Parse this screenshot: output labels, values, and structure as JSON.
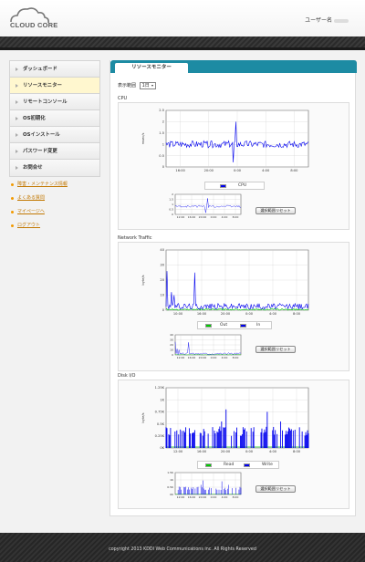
{
  "header": {
    "logo_text": "CLOUD CORE",
    "username_label": "ユーザー名"
  },
  "sidebar": {
    "items": [
      {
        "label": "ダッシュボード"
      },
      {
        "label": "リソースモニター"
      },
      {
        "label": "リモートコンソール"
      },
      {
        "label": "OS初期化"
      },
      {
        "label": "OSインストール"
      },
      {
        "label": "パスワード変更"
      },
      {
        "label": "お問合せ"
      }
    ],
    "links": [
      {
        "label": "障害・メンテナンス情報"
      },
      {
        "label": "よくある質問"
      },
      {
        "label": "マイページへ"
      },
      {
        "label": "ログアウト"
      }
    ]
  },
  "main": {
    "tab_label": "リソースモニター",
    "range_label": "表示範囲",
    "range_value": "1日",
    "reset_label": "選択範囲リセット"
  },
  "colors": {
    "accent": "#1d8ba3",
    "series_blue": "#0000ee",
    "series_green": "#00cc00",
    "link": "#c27700"
  },
  "chart_data": [
    {
      "type": "line",
      "title": "CPU",
      "ylabel": "msec/s",
      "ylim": [
        0,
        2.5
      ],
      "yticks": [
        "2.5",
        "2",
        "1.5",
        "1",
        "0.5",
        "0"
      ],
      "xticks": [
        "16:00",
        "20:00",
        "0:00",
        "4:00",
        "8:00"
      ],
      "series": [
        {
          "name": "CPU",
          "color": "#0000ee",
          "baseline": 1.0,
          "noise": 0.15,
          "spikes": [
            [
              0.49,
              2.0
            ],
            [
              0.47,
              0.2
            ]
          ]
        }
      ],
      "overview_yticks": [
        "2",
        "1.5",
        "1",
        "0.5",
        "0"
      ],
      "overview_xticks": [
        "12:00",
        "16:00",
        "20:00",
        "0:00",
        "4:00",
        "8:00"
      ]
    },
    {
      "type": "line",
      "title": "Network Traffic",
      "ylabel": "byte/s",
      "ylim": [
        0,
        40
      ],
      "yticks": [
        "40",
        "30",
        "20",
        "10",
        "0"
      ],
      "xticks": [
        "10:00",
        "16:00",
        "20:00",
        "0:00",
        "4:00",
        "8:00"
      ],
      "series": [
        {
          "name": "Out",
          "color": "#00cc00",
          "baseline": 0.5,
          "noise": 0.5,
          "spikes": []
        },
        {
          "name": "In",
          "color": "#0000ee",
          "baseline": 2.5,
          "noise": 2.0,
          "spikes": [
            [
              0.01,
              26
            ],
            [
              0.04,
              12
            ],
            [
              0.2,
              25
            ],
            [
              0.06,
              10
            ]
          ]
        }
      ],
      "overview_yticks": [
        "40",
        "30",
        "20",
        "10",
        "0"
      ],
      "overview_xticks": [
        "12:00",
        "16:00",
        "20:00",
        "0:00",
        "4:00",
        "8:00"
      ]
    },
    {
      "type": "bar",
      "title": "Disk I/O",
      "ylabel": "byte/s",
      "ylim": [
        0,
        1.25
      ],
      "yticks": [
        "1.25K",
        "1K",
        "0.75K",
        "0.5K",
        "0.25K",
        "0K"
      ],
      "xticks": [
        "12:00",
        "16:00",
        "20:00",
        "0:00",
        "4:00",
        "8:00"
      ],
      "series": [
        {
          "name": "Read",
          "color": "#00cc00",
          "baseline": 0.02,
          "noise": 0,
          "spikes": []
        },
        {
          "name": "Write",
          "color": "#0000ee",
          "baseline": 0.25,
          "noise": 0.2,
          "spikes": [
            [
              0.42,
              0.8
            ],
            [
              0.71,
              0.75
            ],
            [
              0.39,
              0.55
            ],
            [
              0.8,
              0.55
            ]
          ]
        }
      ],
      "overview_yticks": [
        "1.5K",
        "1K",
        "0.5K",
        "0K"
      ],
      "overview_xticks": [
        "12:00",
        "16:00",
        "20:00",
        "0:00",
        "4:00",
        "8:00"
      ]
    }
  ],
  "footer": {
    "copyright": "copyright 2013 KDDI Web Communications inc. All Rights Reserved"
  }
}
